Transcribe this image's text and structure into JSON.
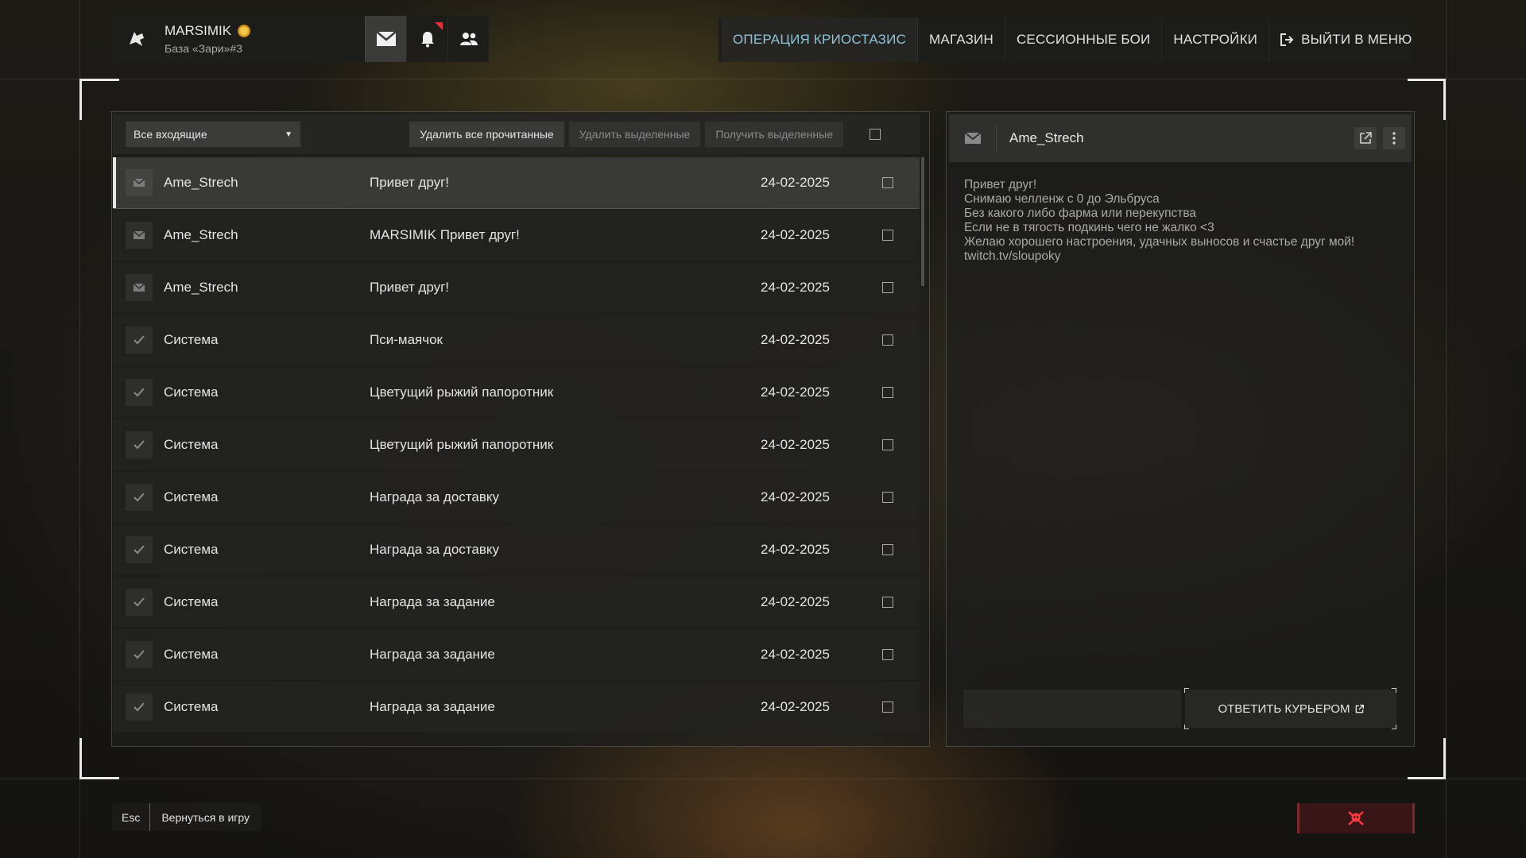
{
  "profile": {
    "name": "MARSIMIK",
    "subtitle": "База «Зари»#3",
    "avatar_icon": "wolf-icon",
    "badge_icon": "sun-badge-icon",
    "notification_color": "#e0313a"
  },
  "topnav": {
    "items": [
      {
        "label": "ОПЕРАЦИЯ КРИОСТАЗИС",
        "active": true
      },
      {
        "label": "МАГАЗИН",
        "active": false
      },
      {
        "label": "СЕССИОННЫЕ БОИ",
        "active": false
      },
      {
        "label": "НАСТРОЙКИ",
        "active": false
      },
      {
        "label": "ВЫЙТИ В МЕНЮ",
        "active": false,
        "icon": "exit-icon"
      }
    ],
    "active_color": "#8fc3d9"
  },
  "toolbar": {
    "filter_value": "Все входящие",
    "delete_read": "Удалить все прочитанные",
    "delete_selected": "Удалить выделенные",
    "receive_selected": "Получить выделенные"
  },
  "messages": [
    {
      "sender": "Ame_Strech",
      "subject": "Привет друг!",
      "date": "24-02-2025",
      "icon": "envelope-icon",
      "selected": true
    },
    {
      "sender": "Ame_Strech",
      "subject": "MARSIMIK Привет друг!",
      "date": "24-02-2025",
      "icon": "envelope-icon"
    },
    {
      "sender": "Ame_Strech",
      "subject": "Привет друг!",
      "date": "24-02-2025",
      "icon": "envelope-icon"
    },
    {
      "sender": "Система",
      "subject": "Пси-маячок",
      "date": "24-02-2025",
      "icon": "check-icon"
    },
    {
      "sender": "Система",
      "subject": "Цветущий рыжий папоротник",
      "date": "24-02-2025",
      "icon": "check-icon"
    },
    {
      "sender": "Система",
      "subject": "Цветущий рыжий папоротник",
      "date": "24-02-2025",
      "icon": "check-icon"
    },
    {
      "sender": "Система",
      "subject": "Награда за доставку",
      "date": "24-02-2025",
      "icon": "check-icon"
    },
    {
      "sender": "Система",
      "subject": "Награда за доставку",
      "date": "24-02-2025",
      "icon": "check-icon"
    },
    {
      "sender": "Система",
      "subject": "Награда за задание",
      "date": "24-02-2025",
      "icon": "check-icon"
    },
    {
      "sender": "Система",
      "subject": "Награда за задание",
      "date": "24-02-2025",
      "icon": "check-icon"
    },
    {
      "sender": "Система",
      "subject": "Награда за задание",
      "date": "24-02-2025",
      "icon": "check-icon"
    }
  ],
  "reader": {
    "from": "Ame_Strech",
    "body": "Привет друг!\nСнимаю челленж с 0 до Эльбруса\nБез какого либо фарма или перекупства\nЕсли не в тягость подкинь чего не жалко <3\nЖелаю хорошего настроения, удачных выносов и счастье друг мой!\ntwitch.tv/sloupoky",
    "reply_label": "ОТВЕТИТЬ КУРЬЕРОМ"
  },
  "footer": {
    "esc_key": "Esc",
    "back_label": "Вернуться в игру",
    "danger_icon": "skull-crossbones-icon"
  }
}
